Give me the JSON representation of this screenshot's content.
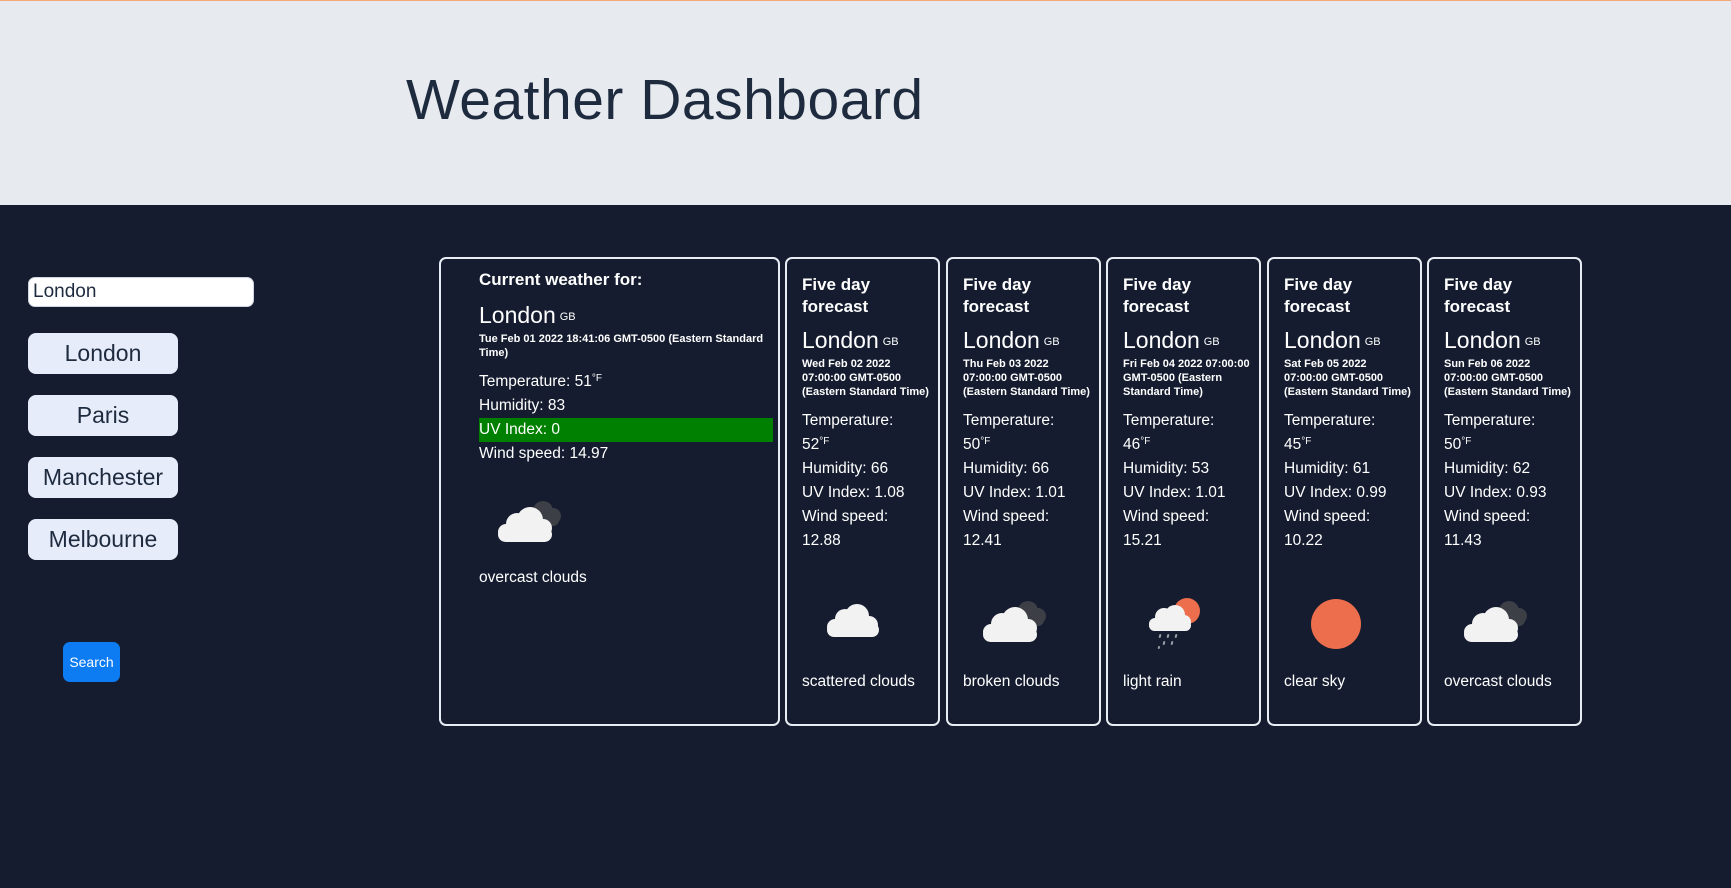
{
  "header": {
    "title": "Weather Dashboard"
  },
  "sidebar": {
    "search_value": "London",
    "history": [
      "London",
      "Paris",
      "Manchester",
      "Melbourne"
    ],
    "search_button": "Search"
  },
  "current": {
    "heading": "Current weather for:",
    "city": "London",
    "country": "GB",
    "date": "Tue Feb 01 2022 18:41:06 GMT-0500 (Eastern Standard Time)",
    "temperature_label": "Temperature: 51",
    "temperature_unit": "°F",
    "humidity": "Humidity: 83",
    "uv": "UV Index: 0",
    "wind": "Wind speed: 14.97",
    "icon": "overcast-clouds-icon",
    "description": "overcast clouds"
  },
  "forecast": [
    {
      "heading": "Five day forecast",
      "city": "London",
      "country": "GB",
      "date": "Wed Feb 02 2022 07:00:00 GMT-0500 (Eastern Standard Time)",
      "temp_label": "Temperature:",
      "temp": "52",
      "unit": "°F",
      "humidity": "Humidity: 66",
      "uv": "UV Index: 1.08",
      "wind_label": "Wind speed:",
      "wind": "12.88",
      "icon": "scattered-clouds-icon",
      "description": "scattered clouds"
    },
    {
      "heading": "Five day forecast",
      "city": "London",
      "country": "GB",
      "date": "Thu Feb 03 2022 07:00:00 GMT-0500 (Eastern Standard Time)",
      "temp_label": "Temperature:",
      "temp": "50",
      "unit": "°F",
      "humidity": "Humidity: 66",
      "uv": "UV Index: 1.01",
      "wind_label": "Wind speed:",
      "wind": "12.41",
      "icon": "broken-clouds-icon",
      "description": "broken clouds"
    },
    {
      "heading": "Five day forecast",
      "city": "London",
      "country": "GB",
      "date": "Fri Feb 04 2022 07:00:00 GMT-0500 (Eastern Standard Time)",
      "temp_label": "Temperature:",
      "temp": "46",
      "unit": "°F",
      "humidity": "Humidity: 53",
      "uv": "UV Index: 1.01",
      "wind_label": "Wind speed:",
      "wind": "15.21",
      "icon": "light-rain-icon",
      "description": "light rain"
    },
    {
      "heading": "Five day forecast",
      "city": "London",
      "country": "GB",
      "date": "Sat Feb 05 2022 07:00:00 GMT-0500 (Eastern Standard Time)",
      "temp_label": "Temperature:",
      "temp": "45",
      "unit": "°F",
      "humidity": "Humidity: 61",
      "uv": "UV Index: 0.99",
      "wind_label": "Wind speed:",
      "wind": "10.22",
      "icon": "clear-sky-icon",
      "description": "clear sky"
    },
    {
      "heading": "Five day forecast",
      "city": "London",
      "country": "GB",
      "date": "Sun Feb 06 2022 07:00:00 GMT-0500 (Eastern Standard Time)",
      "temp_label": "Temperature:",
      "temp": "50",
      "unit": "°F",
      "humidity": "Humidity: 62",
      "uv": "UV Index: 0.93",
      "wind_label": "Wind speed:",
      "wind": "11.43",
      "icon": "overcast-clouds-icon",
      "description": "overcast clouds"
    }
  ],
  "colors": {
    "background": "#151c2f",
    "header_bg": "#e7ebef",
    "uv_low": "#008000",
    "search_button": "#0d7cf2",
    "sun": "#ec6e4c"
  }
}
